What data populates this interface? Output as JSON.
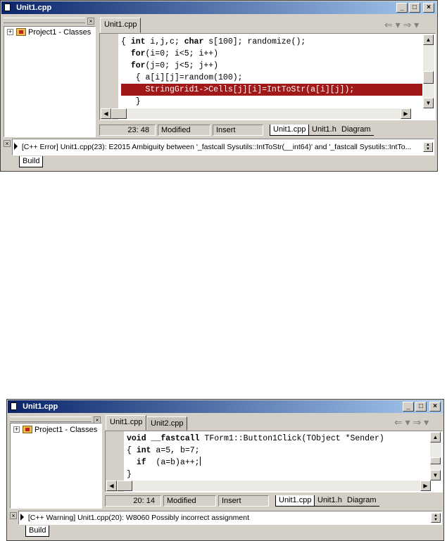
{
  "top": {
    "title": "Unit1.cpp",
    "tree_item": "Project1 - Classes",
    "tabs": [
      "Unit1.cpp"
    ],
    "code": {
      "l1_a": "{ ",
      "l1_kw1": "int",
      "l1_b": " i,j,c; ",
      "l1_kw2": "char",
      "l1_c": " s[100]; randomize();",
      "l2_ind": "  ",
      "l2_kw": "for",
      "l2_rest": "(i=0; i<5; i++)",
      "l3_ind": "  ",
      "l3_kw": "for",
      "l3_rest": "(j=0; j<5; j++)",
      "l4": "   { a[i][j]=random(100);",
      "l5": "     StringGrid1->Cells[j][i]=IntToStr(a[i][j]);",
      "l6": "   }"
    },
    "status": {
      "position": "23: 48",
      "state": "Modified",
      "mode": "Insert"
    },
    "file_tabs": [
      "Unit1.cpp",
      "Unit1.h",
      "Diagram"
    ],
    "message": "[C++ Error] Unit1.cpp(23): E2015 Ambiguity between '_fastcall Sysutils::IntToStr(__int64)' and '_fastcall Sysutils::IntTo...",
    "bottom_tab": "Build"
  },
  "bottom": {
    "title": "Unit1.cpp",
    "tree_item": "Project1 - Classes",
    "tabs": [
      "Unit1.cpp",
      "Unit2.cpp"
    ],
    "code": {
      "l1_kw1": "void",
      "l1_sp": " ",
      "l1_kw2": "__fastcall",
      "l1_rest": " TForm1::Button1Click(TObject *Sender)",
      "l2_a": "{ ",
      "l2_kw": "int",
      "l2_rest": " a=5, b=7;",
      "l3_ind": "  ",
      "l3_kw": "if",
      "l3_rest": "  (a=b)a++;",
      "l4": "}"
    },
    "status": {
      "position": "20: 14",
      "state": "Modified",
      "mode": "Insert"
    },
    "file_tabs": [
      "Unit1.cpp",
      "Unit1.h",
      "Diagram"
    ],
    "message": "[C++ Warning] Unit1.cpp(20): W8060 Possibly incorrect assignment",
    "bottom_tab": "Build"
  },
  "icons": {
    "title": "document-icon",
    "min": "minimize-icon",
    "max": "maximize-icon",
    "close": "close-icon",
    "nav_back": "back-arrow-icon",
    "nav_fwd": "forward-arrow-icon",
    "folder": "classes-folder-icon",
    "expand": "expand-plus-icon"
  },
  "glyphs": {
    "minimize": "_",
    "maximize": "□",
    "close": "×",
    "plus": "+",
    "nav": "⇐ ▾ ⇒ ▾",
    "pane_close": "×"
  },
  "colors": {
    "title_gradient_start": "#0a246a",
    "title_gradient_end": "#a6caf0",
    "error_line": "#a01818",
    "window_bg": "#d4d0c8"
  }
}
